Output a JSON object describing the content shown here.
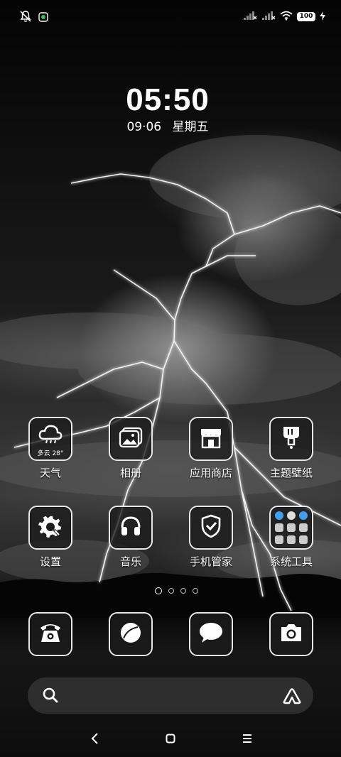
{
  "status_bar": {
    "icons_left": [
      "bell-off-icon",
      "notification-app-icon"
    ],
    "icons_right": [
      "signal-1-icon",
      "signal-2-icon",
      "wifi-icon",
      "charging-icon"
    ],
    "battery_level": "100"
  },
  "lockclock": {
    "time": "05:50",
    "date": "09·06",
    "weekday": "星期五"
  },
  "apps_row1": [
    {
      "label": "天气",
      "icon": "weather-icon",
      "sub": "多云 28°"
    },
    {
      "label": "相册",
      "icon": "gallery-icon"
    },
    {
      "label": "应用商店",
      "icon": "store-icon"
    },
    {
      "label": "主题壁纸",
      "icon": "themes-icon"
    }
  ],
  "apps_row2": [
    {
      "label": "设置",
      "icon": "settings-icon"
    },
    {
      "label": "音乐",
      "icon": "music-icon"
    },
    {
      "label": "手机管家",
      "icon": "security-icon"
    },
    {
      "label": "系统工具",
      "icon": "tools-folder-icon"
    }
  ],
  "dock": [
    {
      "icon": "phone-icon"
    },
    {
      "icon": "browser-icon"
    },
    {
      "icon": "messages-icon"
    },
    {
      "icon": "camera-icon"
    }
  ],
  "page_indicator": {
    "pages": 4,
    "current": 1
  },
  "search_bar": {
    "placeholder": ""
  },
  "nav_bar": [
    "back-icon",
    "home-icon",
    "recents-icon"
  ]
}
